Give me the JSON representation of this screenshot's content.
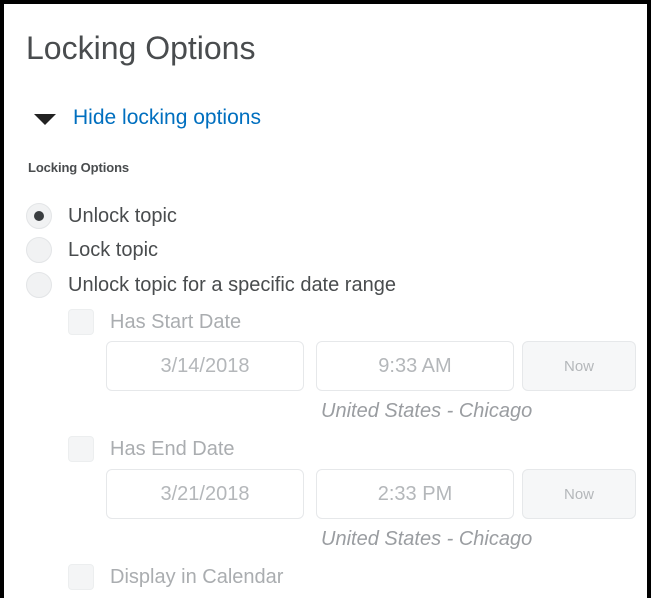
{
  "title": "Locking Options",
  "toggle": {
    "icon": "caret-down-icon",
    "label": "Hide locking options"
  },
  "section_label": "Locking Options",
  "radios": [
    {
      "label": "Unlock topic",
      "selected": true
    },
    {
      "label": "Lock topic",
      "selected": false
    },
    {
      "label": "Unlock topic for a specific date range",
      "selected": false
    }
  ],
  "start": {
    "checkbox_label": "Has Start Date",
    "date": "3/14/2018",
    "time": "9:33 AM",
    "now_label": "Now",
    "timezone": "United States - Chicago"
  },
  "end": {
    "checkbox_label": "Has End Date",
    "date": "3/21/2018",
    "time": "2:33 PM",
    "now_label": "Now",
    "timezone": "United States - Chicago"
  },
  "calendar": {
    "checkbox_label": "Display in Calendar"
  },
  "colors": {
    "link": "#006fbf",
    "text": "#494c4e",
    "disabled_text": "#aaadb0"
  }
}
